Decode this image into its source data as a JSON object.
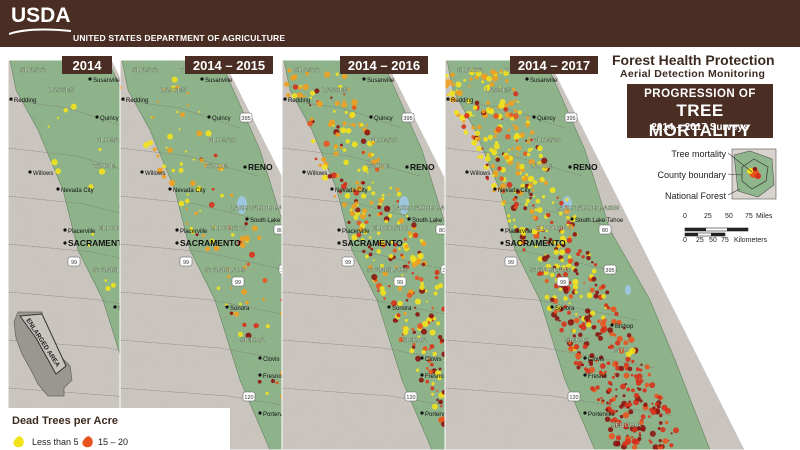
{
  "header": {
    "logo_text": "USDA",
    "department": "UNITED STATES DEPARTMENT OF AGRICULTURE"
  },
  "agency": {
    "line1": "Forest Health Protection",
    "line2": "Aerial Detection Monitoring"
  },
  "title": {
    "line1": "PROGRESSION OF",
    "line2": "TREE MORTALITY",
    "line3": "2014 – 2017 Surveys"
  },
  "panels": [
    {
      "year_label": "2014",
      "severity": 0
    },
    {
      "year_label": "2014 – 2015",
      "severity": 1
    },
    {
      "year_label": "2014 – 2016",
      "severity": 2
    },
    {
      "year_label": "2014 – 2017",
      "severity": 3
    }
  ],
  "places": [
    {
      "name": "SHASTA",
      "type": "forest"
    },
    {
      "name": "TRINITY",
      "type": "forest"
    },
    {
      "name": "LASSEN",
      "type": "forest"
    },
    {
      "name": "Redding",
      "type": "city"
    },
    {
      "name": "Susanville",
      "type": "city"
    },
    {
      "name": "Quincy",
      "type": "city"
    },
    {
      "name": "PLUMAS",
      "type": "forest"
    },
    {
      "name": "Willows",
      "type": "city"
    },
    {
      "name": "TAHOE",
      "type": "forest"
    },
    {
      "name": "RENO",
      "type": "city-major"
    },
    {
      "name": "Nevada City",
      "type": "city"
    },
    {
      "name": "LAKE TAHOE BASIN",
      "type": "forest"
    },
    {
      "name": "South Lake Tahoe",
      "type": "city"
    },
    {
      "name": "Placerville",
      "type": "city"
    },
    {
      "name": "ELDORADO",
      "type": "forest"
    },
    {
      "name": "SACRAMENTO",
      "type": "city-major"
    },
    {
      "name": "STANISLAUS",
      "type": "forest"
    },
    {
      "name": "Sonora",
      "type": "city"
    },
    {
      "name": "Bishop",
      "type": "city"
    },
    {
      "name": "SIERRA",
      "type": "forest"
    },
    {
      "name": "INYO",
      "type": "forest"
    },
    {
      "name": "Clovis",
      "type": "city"
    },
    {
      "name": "Fresno",
      "type": "city"
    },
    {
      "name": "Porterville",
      "type": "city"
    },
    {
      "name": "SEQUOIA",
      "type": "forest"
    }
  ],
  "highways": [
    "395",
    "80",
    "99",
    "395",
    "99",
    "120"
  ],
  "inset_legend": {
    "tree_mortality": "Tree mortality",
    "county_boundary": "County boundary",
    "national_forest": "National Forest"
  },
  "scale_bar": {
    "miles_ticks": [
      "0",
      "25",
      "50",
      "75"
    ],
    "miles_unit": "Miles",
    "km_ticks": [
      "0",
      "25",
      "50",
      "75"
    ],
    "km_unit": "Kilometers"
  },
  "locator": {
    "label": "ENLARGED AREA"
  },
  "dead_trees_legend": {
    "title": "Dead Trees per Acre",
    "items": [
      {
        "label": "Less than 5",
        "color": "#f2e21c"
      },
      {
        "label": "15 – 20",
        "color": "#e8541e"
      }
    ]
  },
  "colors": {
    "header_brown": "#4a2e24",
    "forest_green": "#8fb58c",
    "terrain_gray": "#c9c4bc",
    "mortality_yellow": "#f2e21c",
    "mortality_orange": "#f0a020",
    "mortality_red": "#d8301a",
    "mortality_dark": "#8c1410"
  }
}
